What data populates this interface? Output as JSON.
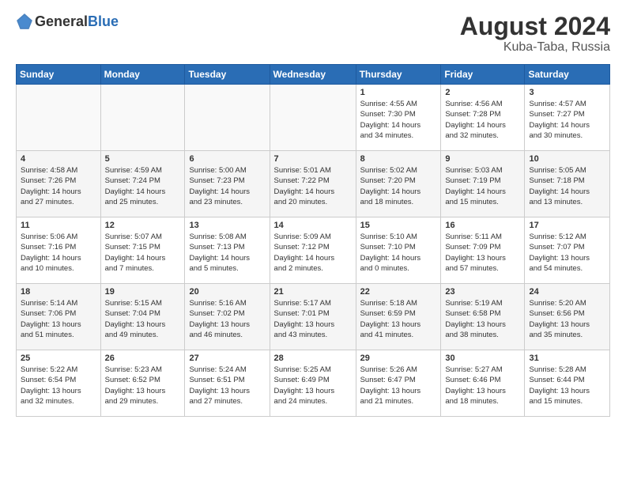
{
  "header": {
    "logo_general": "General",
    "logo_blue": "Blue",
    "month_year": "August 2024",
    "location": "Kuba-Taba, Russia"
  },
  "weekdays": [
    "Sunday",
    "Monday",
    "Tuesday",
    "Wednesday",
    "Thursday",
    "Friday",
    "Saturday"
  ],
  "weeks": [
    [
      {
        "day": "",
        "info": ""
      },
      {
        "day": "",
        "info": ""
      },
      {
        "day": "",
        "info": ""
      },
      {
        "day": "",
        "info": ""
      },
      {
        "day": "1",
        "info": "Sunrise: 4:55 AM\nSunset: 7:30 PM\nDaylight: 14 hours\nand 34 minutes."
      },
      {
        "day": "2",
        "info": "Sunrise: 4:56 AM\nSunset: 7:28 PM\nDaylight: 14 hours\nand 32 minutes."
      },
      {
        "day": "3",
        "info": "Sunrise: 4:57 AM\nSunset: 7:27 PM\nDaylight: 14 hours\nand 30 minutes."
      }
    ],
    [
      {
        "day": "4",
        "info": "Sunrise: 4:58 AM\nSunset: 7:26 PM\nDaylight: 14 hours\nand 27 minutes."
      },
      {
        "day": "5",
        "info": "Sunrise: 4:59 AM\nSunset: 7:24 PM\nDaylight: 14 hours\nand 25 minutes."
      },
      {
        "day": "6",
        "info": "Sunrise: 5:00 AM\nSunset: 7:23 PM\nDaylight: 14 hours\nand 23 minutes."
      },
      {
        "day": "7",
        "info": "Sunrise: 5:01 AM\nSunset: 7:22 PM\nDaylight: 14 hours\nand 20 minutes."
      },
      {
        "day": "8",
        "info": "Sunrise: 5:02 AM\nSunset: 7:20 PM\nDaylight: 14 hours\nand 18 minutes."
      },
      {
        "day": "9",
        "info": "Sunrise: 5:03 AM\nSunset: 7:19 PM\nDaylight: 14 hours\nand 15 minutes."
      },
      {
        "day": "10",
        "info": "Sunrise: 5:05 AM\nSunset: 7:18 PM\nDaylight: 14 hours\nand 13 minutes."
      }
    ],
    [
      {
        "day": "11",
        "info": "Sunrise: 5:06 AM\nSunset: 7:16 PM\nDaylight: 14 hours\nand 10 minutes."
      },
      {
        "day": "12",
        "info": "Sunrise: 5:07 AM\nSunset: 7:15 PM\nDaylight: 14 hours\nand 7 minutes."
      },
      {
        "day": "13",
        "info": "Sunrise: 5:08 AM\nSunset: 7:13 PM\nDaylight: 14 hours\nand 5 minutes."
      },
      {
        "day": "14",
        "info": "Sunrise: 5:09 AM\nSunset: 7:12 PM\nDaylight: 14 hours\nand 2 minutes."
      },
      {
        "day": "15",
        "info": "Sunrise: 5:10 AM\nSunset: 7:10 PM\nDaylight: 14 hours\nand 0 minutes."
      },
      {
        "day": "16",
        "info": "Sunrise: 5:11 AM\nSunset: 7:09 PM\nDaylight: 13 hours\nand 57 minutes."
      },
      {
        "day": "17",
        "info": "Sunrise: 5:12 AM\nSunset: 7:07 PM\nDaylight: 13 hours\nand 54 minutes."
      }
    ],
    [
      {
        "day": "18",
        "info": "Sunrise: 5:14 AM\nSunset: 7:06 PM\nDaylight: 13 hours\nand 51 minutes."
      },
      {
        "day": "19",
        "info": "Sunrise: 5:15 AM\nSunset: 7:04 PM\nDaylight: 13 hours\nand 49 minutes."
      },
      {
        "day": "20",
        "info": "Sunrise: 5:16 AM\nSunset: 7:02 PM\nDaylight: 13 hours\nand 46 minutes."
      },
      {
        "day": "21",
        "info": "Sunrise: 5:17 AM\nSunset: 7:01 PM\nDaylight: 13 hours\nand 43 minutes."
      },
      {
        "day": "22",
        "info": "Sunrise: 5:18 AM\nSunset: 6:59 PM\nDaylight: 13 hours\nand 41 minutes."
      },
      {
        "day": "23",
        "info": "Sunrise: 5:19 AM\nSunset: 6:58 PM\nDaylight: 13 hours\nand 38 minutes."
      },
      {
        "day": "24",
        "info": "Sunrise: 5:20 AM\nSunset: 6:56 PM\nDaylight: 13 hours\nand 35 minutes."
      }
    ],
    [
      {
        "day": "25",
        "info": "Sunrise: 5:22 AM\nSunset: 6:54 PM\nDaylight: 13 hours\nand 32 minutes."
      },
      {
        "day": "26",
        "info": "Sunrise: 5:23 AM\nSunset: 6:52 PM\nDaylight: 13 hours\nand 29 minutes."
      },
      {
        "day": "27",
        "info": "Sunrise: 5:24 AM\nSunset: 6:51 PM\nDaylight: 13 hours\nand 27 minutes."
      },
      {
        "day": "28",
        "info": "Sunrise: 5:25 AM\nSunset: 6:49 PM\nDaylight: 13 hours\nand 24 minutes."
      },
      {
        "day": "29",
        "info": "Sunrise: 5:26 AM\nSunset: 6:47 PM\nDaylight: 13 hours\nand 21 minutes."
      },
      {
        "day": "30",
        "info": "Sunrise: 5:27 AM\nSunset: 6:46 PM\nDaylight: 13 hours\nand 18 minutes."
      },
      {
        "day": "31",
        "info": "Sunrise: 5:28 AM\nSunset: 6:44 PM\nDaylight: 13 hours\nand 15 minutes."
      }
    ]
  ]
}
